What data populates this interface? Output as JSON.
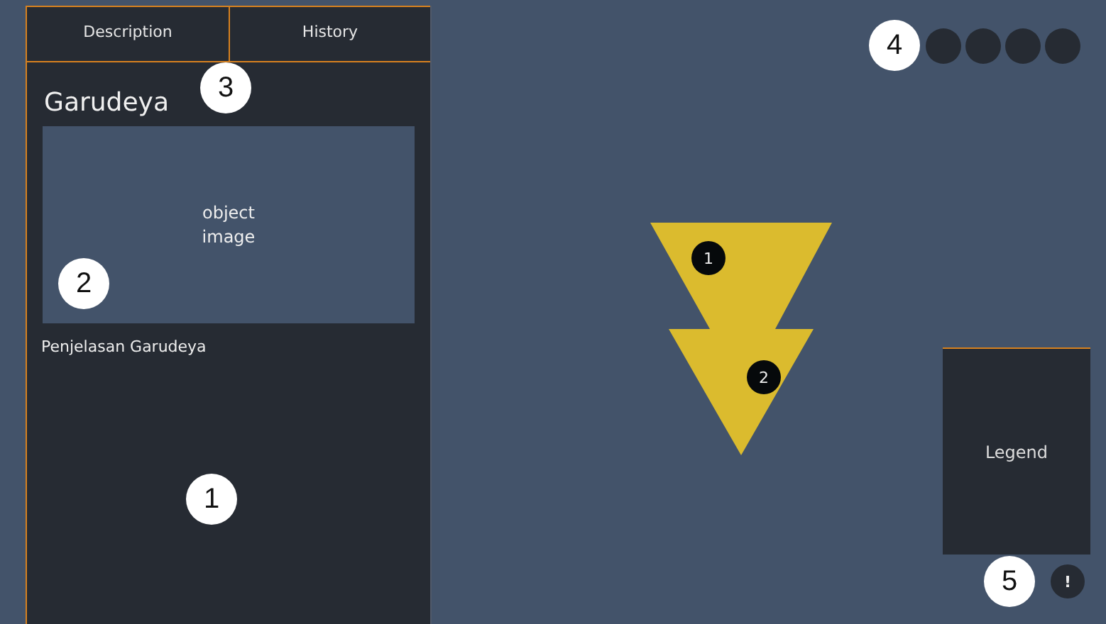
{
  "tabs": [
    {
      "label": "Description",
      "selected": false
    },
    {
      "label": "History",
      "selected": false
    }
  ],
  "panel": {
    "title": "Garudeya",
    "image_label": "object\nimage",
    "caption": "Penjelasan Garudeya"
  },
  "canvas": {
    "markers": [
      "1",
      "2"
    ],
    "legend": "Legend",
    "info_button": "!"
  },
  "callouts": [
    "1",
    "2",
    "3",
    "4",
    "5"
  ]
}
